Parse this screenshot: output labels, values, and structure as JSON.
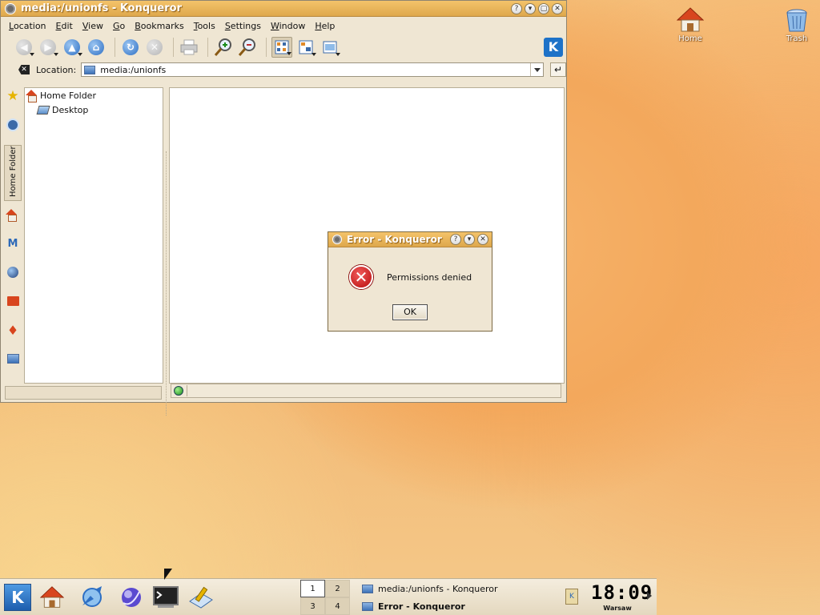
{
  "desktop": {
    "icons": [
      {
        "label": "Home",
        "icon": "home-icon"
      },
      {
        "label": "Trash",
        "icon": "trash-icon"
      }
    ]
  },
  "konqueror": {
    "title": "media:/unionfs - Konqueror",
    "title_buttons": [
      "?",
      "▾",
      "▢",
      "✕"
    ],
    "menu": [
      "Location",
      "Edit",
      "View",
      "Go",
      "Bookmarks",
      "Tools",
      "Settings",
      "Window",
      "Help"
    ],
    "location": {
      "label": "Location:",
      "value": "media:/unionfs"
    },
    "sidebar_tab": "Home Folder",
    "tree": [
      {
        "label": "Home Folder",
        "icon": "home-folder-icon"
      },
      {
        "label": "Desktop",
        "icon": "desktop-icon"
      }
    ]
  },
  "error_dialog": {
    "title": "Error - Konqueror",
    "message": "Permissions denied",
    "ok_label": "OK"
  },
  "taskbar": {
    "pager": [
      "1",
      "2",
      "3",
      "4"
    ],
    "active_desktop": "1",
    "tasks": [
      {
        "label": "media:/unionfs - Konqueror",
        "icon": "konqueror-icon"
      },
      {
        "label": "Error - Konqueror",
        "icon": "error-app-icon"
      }
    ],
    "clock": {
      "time": "18:09",
      "zone": "Warsaw"
    }
  },
  "colors": {
    "titlebar": "#dea84c",
    "window_bg": "#efe6d3",
    "desktop": "#f3a85c"
  }
}
